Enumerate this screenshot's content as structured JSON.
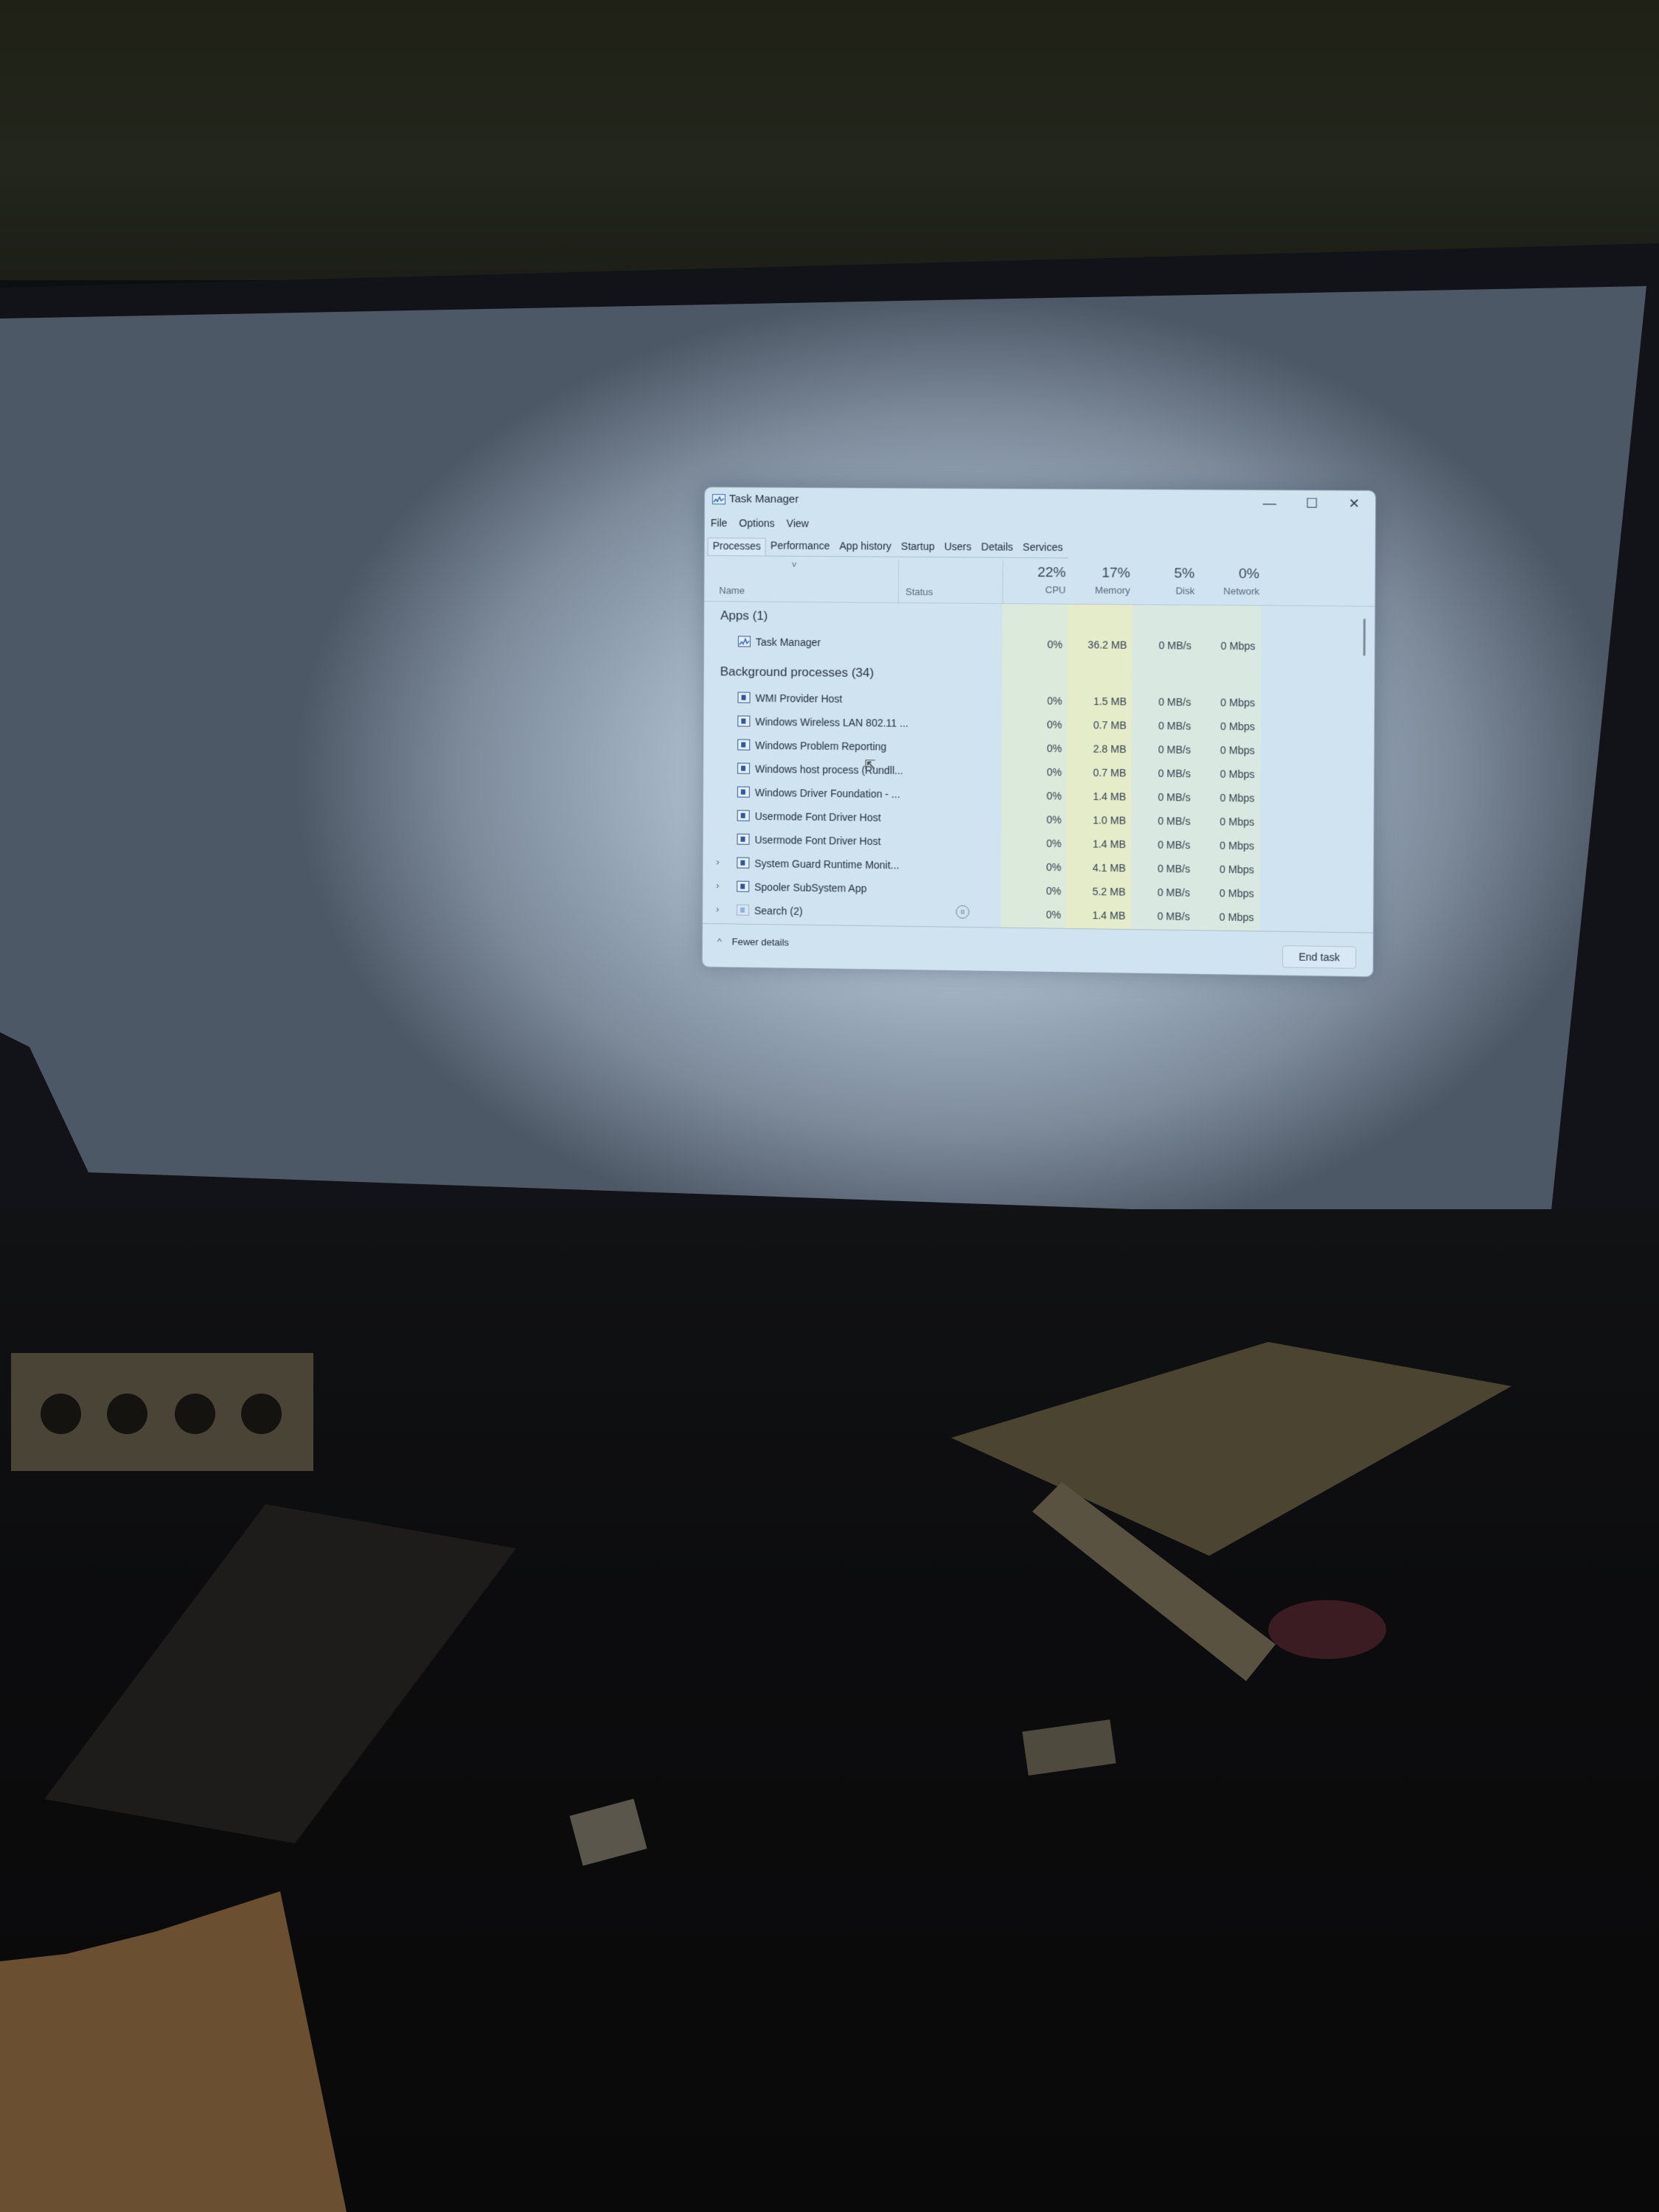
{
  "window": {
    "title": "Task Manager",
    "icon": "task-manager-icon",
    "controls": {
      "minimize": "—",
      "maximize": "☐",
      "close": "✕"
    }
  },
  "menu": [
    {
      "label": "File"
    },
    {
      "label": "Options"
    },
    {
      "label": "View"
    }
  ],
  "tabs": [
    {
      "label": "Processes",
      "active": true
    },
    {
      "label": "Performance"
    },
    {
      "label": "App history"
    },
    {
      "label": "Startup"
    },
    {
      "label": "Users"
    },
    {
      "label": "Details"
    },
    {
      "label": "Services"
    }
  ],
  "columns": {
    "name": "Name",
    "status": "Status",
    "cpu": {
      "label": "CPU",
      "percent": "22%"
    },
    "memory": {
      "label": "Memory",
      "percent": "17%"
    },
    "disk": {
      "label": "Disk",
      "percent": "5%"
    },
    "network": {
      "label": "Network",
      "percent": "0%"
    },
    "sort_indicator": "˅"
  },
  "sections": {
    "apps": "Apps (1)",
    "background": "Background processes (34)"
  },
  "apps": [
    {
      "name": "Task Manager",
      "icon": "task-manager-icon",
      "cpu": "0%",
      "memory": "36.2 MB",
      "disk": "0 MB/s",
      "network": "0 Mbps"
    }
  ],
  "background": [
    {
      "name": "WMI Provider Host",
      "icon": "wmi-icon",
      "expandable": false,
      "status": "",
      "cpu": "0%",
      "memory": "1.5 MB",
      "disk": "0 MB/s",
      "network": "0 Mbps"
    },
    {
      "name": "Windows Wireless LAN 802.11 ...",
      "icon": "app-window-icon",
      "expandable": false,
      "status": "",
      "cpu": "0%",
      "memory": "0.7 MB",
      "disk": "0 MB/s",
      "network": "0 Mbps"
    },
    {
      "name": "Windows Problem Reporting",
      "icon": "problem-reporting-icon",
      "expandable": false,
      "status": "",
      "cpu": "0%",
      "memory": "2.8 MB",
      "disk": "0 MB/s",
      "network": "0 Mbps"
    },
    {
      "name": "Windows host process (Rundll...",
      "icon": "app-window-icon",
      "expandable": false,
      "status": "",
      "cpu": "0%",
      "memory": "0.7 MB",
      "disk": "0 MB/s",
      "network": "0 Mbps"
    },
    {
      "name": "Windows Driver Foundation - ...",
      "icon": "app-window-icon",
      "expandable": false,
      "status": "",
      "cpu": "0%",
      "memory": "1.4 MB",
      "disk": "0 MB/s",
      "network": "0 Mbps"
    },
    {
      "name": "Usermode Font Driver Host",
      "icon": "app-window-icon",
      "expandable": false,
      "status": "",
      "cpu": "0%",
      "memory": "1.0 MB",
      "disk": "0 MB/s",
      "network": "0 Mbps"
    },
    {
      "name": "Usermode Font Driver Host",
      "icon": "app-window-icon",
      "expandable": false,
      "status": "",
      "cpu": "0%",
      "memory": "1.4 MB",
      "disk": "0 MB/s",
      "network": "0 Mbps"
    },
    {
      "name": "System Guard Runtime Monit...",
      "icon": "app-window-icon",
      "expandable": true,
      "status": "",
      "cpu": "0%",
      "memory": "4.1 MB",
      "disk": "0 MB/s",
      "network": "0 Mbps"
    },
    {
      "name": "Spooler SubSystem App",
      "icon": "printer-icon",
      "expandable": true,
      "status": "",
      "cpu": "0%",
      "memory": "5.2 MB",
      "disk": "0 MB/s",
      "network": "0 Mbps"
    },
    {
      "name": "Search (2)",
      "icon": "search-app-icon",
      "expandable": true,
      "status": "suspended",
      "cpu": "0%",
      "memory": "1.4 MB",
      "disk": "0 MB/s",
      "network": "0 Mbps"
    }
  ],
  "footer": {
    "fewer_details": "Fewer details",
    "end_task": "End task"
  },
  "glyphs": {
    "expand": "›",
    "collapse_up": "^",
    "suspended": "II"
  }
}
